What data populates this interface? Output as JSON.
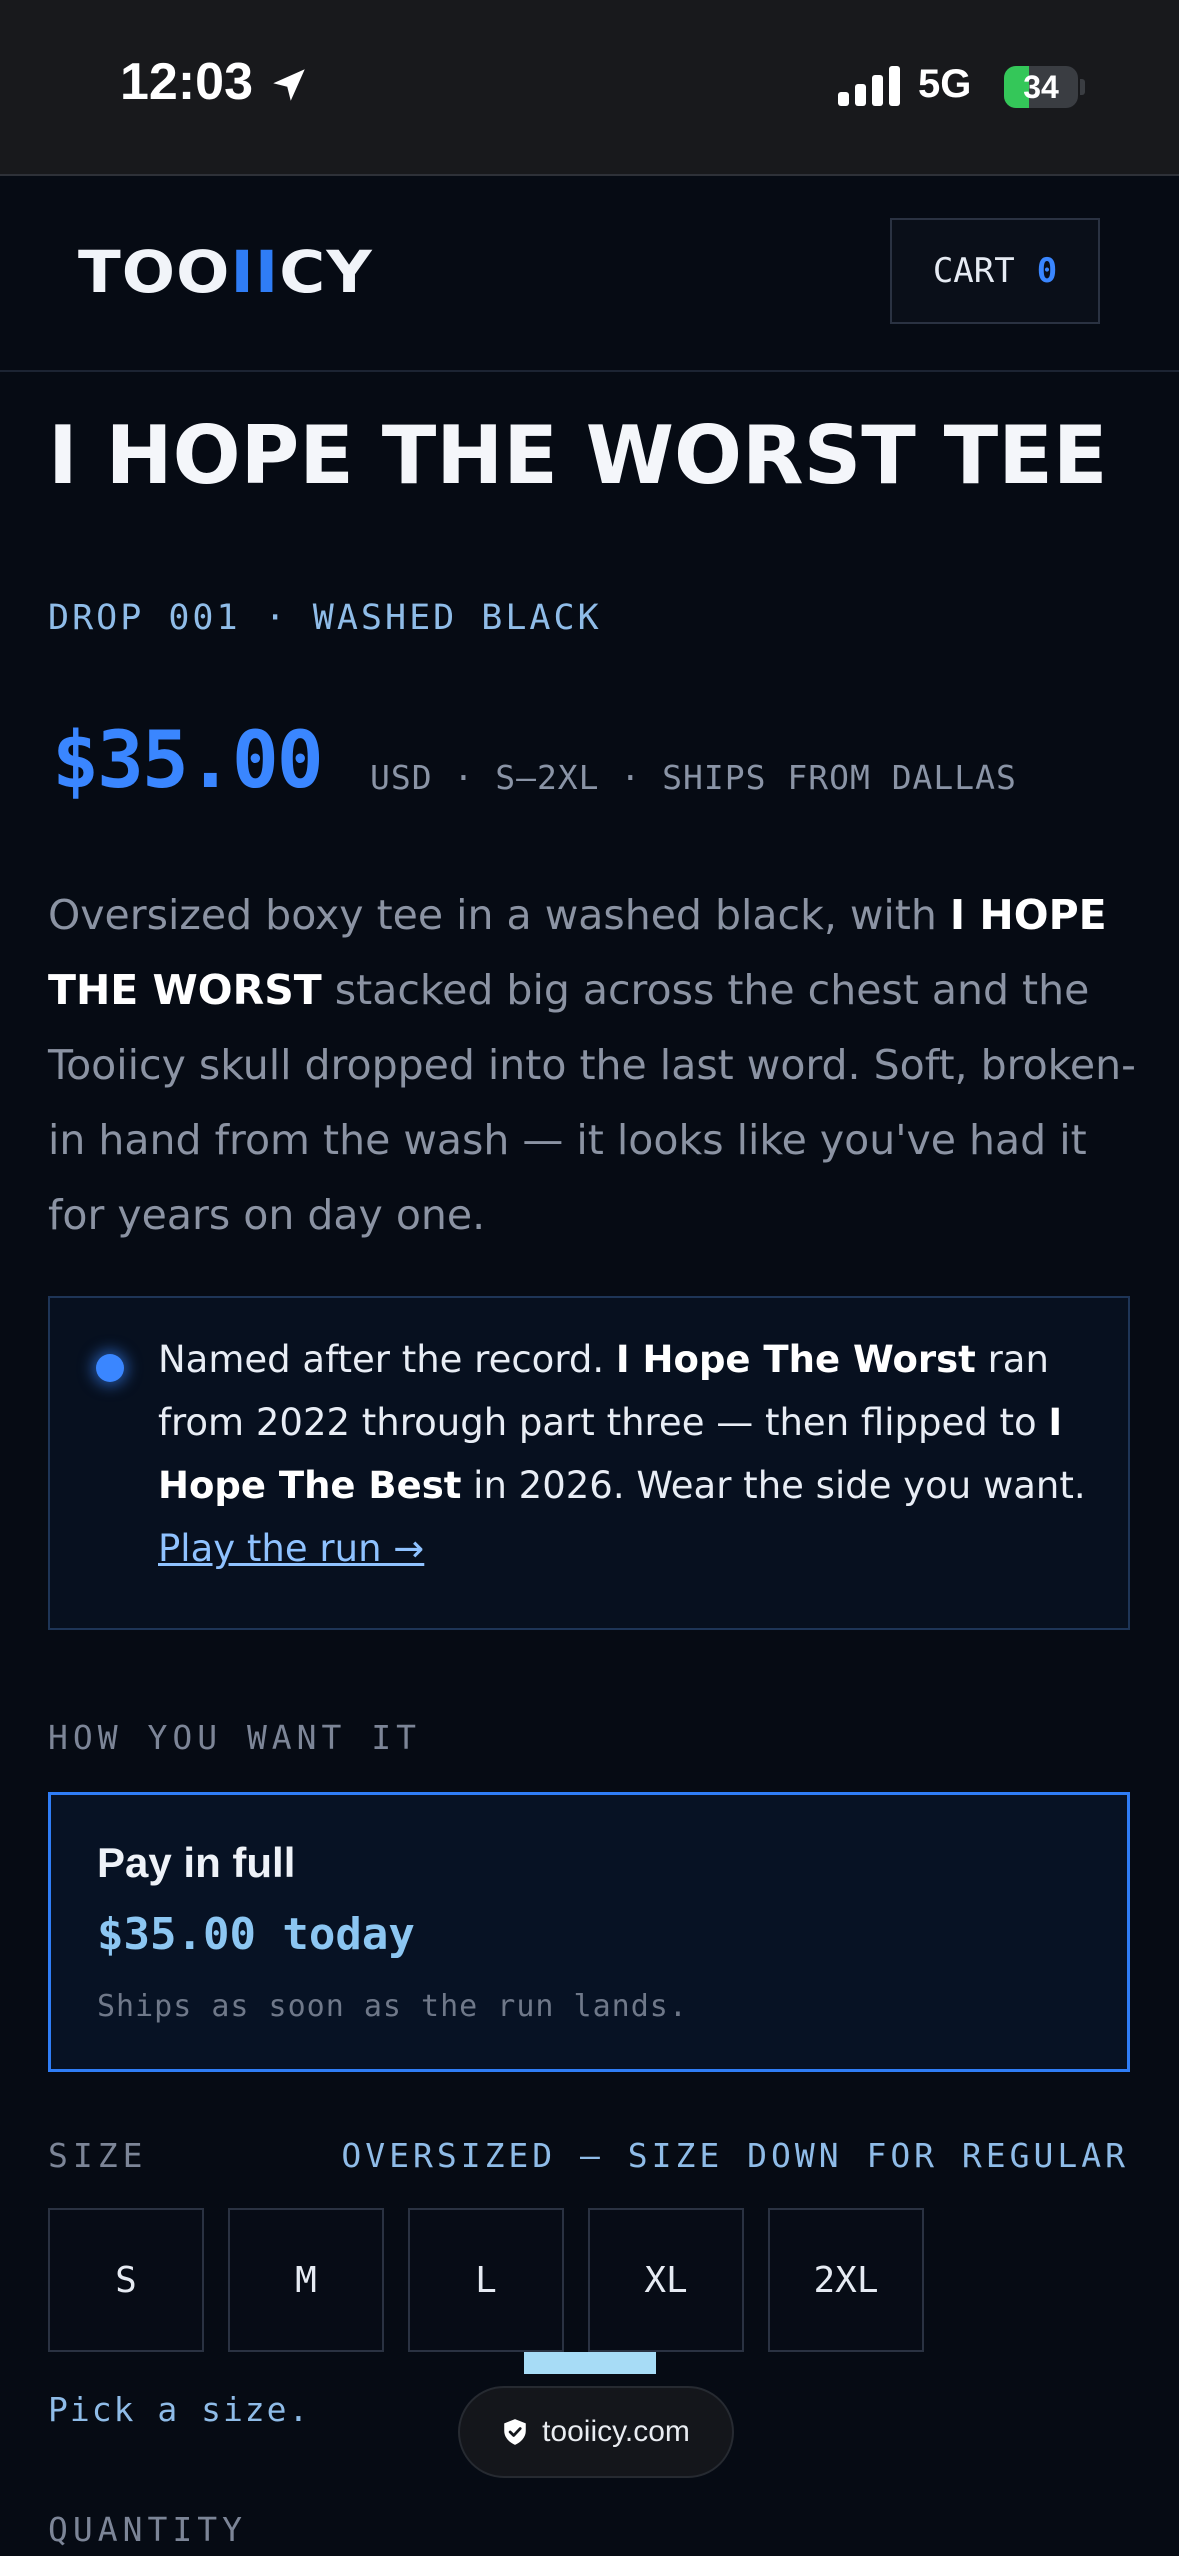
{
  "status_bar": {
    "time": "12:03",
    "network": "5G",
    "battery": "34",
    "battery_level": 0.34,
    "battery_color": "#34c759"
  },
  "header": {
    "logo_part1": "TOO",
    "logo_accent": "II",
    "logo_part2": "CY",
    "cart_label": "CART",
    "cart_count": "0",
    "accent_color": "#2f7df6"
  },
  "product": {
    "title": "I HOPE THE WORST TEE",
    "drop_line": "DROP 001 · WASHED BLACK",
    "price": "$35.00",
    "price_meta": "USD · S–2XL · SHIPS FROM DALLAS",
    "description": {
      "part1": "Oversized boxy tee in a washed black, with ",
      "bold1": "I HOPE THE WORST",
      "part2": " stacked big across the chest and the Tooiicy skull dropped into the last word. Soft, broken-in hand from the wash — it looks like you've had it for years on day one."
    }
  },
  "callout": {
    "part1": "Named after the record. ",
    "bold1": "I Hope The Worst",
    "part2": " ran from 2022 through part three — then flipped to ",
    "bold2": "I Hope The Best",
    "part3": " in 2026. Wear the side you want. ",
    "link": "Play the run →"
  },
  "purchase": {
    "section_label": "HOW YOU WANT IT",
    "option_title": "Pay in full",
    "option_price": "$35.00 today",
    "option_note": "Ships as soon as the run lands."
  },
  "size": {
    "label": "SIZE",
    "hint": "OVERSIZED — SIZE DOWN FOR REGULAR",
    "options": [
      "S",
      "M",
      "L",
      "XL",
      "2XL"
    ],
    "error": "Pick a size."
  },
  "quantity": {
    "label": "QUANTITY"
  },
  "browser": {
    "url": "tooiicy.com"
  }
}
